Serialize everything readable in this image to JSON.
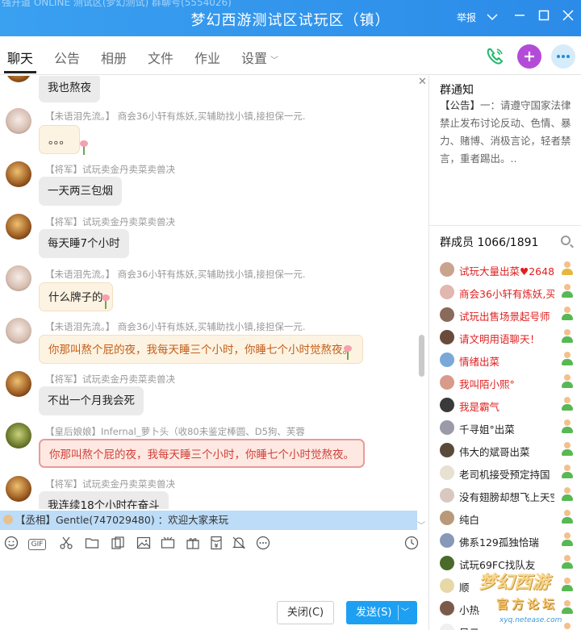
{
  "window": {
    "ghost_text": "强开道 ONLINE   测试区(梦幻测试)   群聊号(5554026)",
    "title": "梦幻西游测试区试玩区（镇）",
    "report_label": "举报"
  },
  "tabs": [
    {
      "label": "聊天"
    },
    {
      "label": "公告"
    },
    {
      "label": "相册"
    },
    {
      "label": "文件"
    },
    {
      "label": "作业"
    },
    {
      "label": "设置"
    }
  ],
  "messages": [
    {
      "meta": "",
      "text": "我也熬夜"
    },
    {
      "meta": "【未语泪先流。】 商会36小轩有炼妖,买辅助找小镇,接担保一元.",
      "text": "。。。"
    },
    {
      "meta": "【将军】试玩卖金丹卖菜卖兽决",
      "text": "一天两三包烟"
    },
    {
      "meta": "【将军】试玩卖金丹卖菜卖兽决",
      "text": "每天睡7个小时"
    },
    {
      "meta": "【未语泪先流。】 商会36小轩有炼妖,买辅助找小镇,接担保一元.",
      "text": "什么牌子的"
    },
    {
      "meta": "【未语泪先流。】 商会36小轩有炼妖,买辅助找小镇,接担保一元.",
      "text": "你那叫熬个屁的夜，我每天睡三个小时，你睡七个小时觉熬夜。"
    },
    {
      "meta": "【将军】试玩卖金丹卖菜卖兽决",
      "text": "不出一个月我会死"
    },
    {
      "meta": "【皇后娘娘】Infernal_萝卜头（收80未鉴定棒圆、D5狗、芙蓉",
      "text": "你那叫熬个屁的夜，我每天睡三个小时，你睡七个小时觉熬夜。"
    },
    {
      "meta": "【将军】试玩卖金丹卖菜卖兽决",
      "text": "我连续18个小时在奋斗"
    }
  ],
  "notice_strip": "【丞相】Gentle(747029480) ：欢迎大家来玩",
  "buttons": {
    "close_label": "关闭(C)",
    "send_label": "发送(S)"
  },
  "group_notice": {
    "title": "群通知",
    "tag": "【公告】",
    "body": "一：请遵守国家法律禁止发布讨论反动、色情、暴力、赌博、消极言论，轻者禁言，重者踢出。.."
  },
  "members": {
    "title": "群成员 1066/1891",
    "list": [
      {
        "name": "试玩大量出菜♥26485",
        "color": "#e02020"
      },
      {
        "name": "商会36小轩有炼妖,买",
        "color": "#e02020"
      },
      {
        "name": "试玩出售场景起号师",
        "color": "#e02020"
      },
      {
        "name": "请文明用语聊天！",
        "color": "#e02020"
      },
      {
        "name": "情绪出菜",
        "color": "#e02020"
      },
      {
        "name": "我叫陌小熙°",
        "color": "#e02020"
      },
      {
        "name": "我是霸气",
        "color": "#e02020"
      },
      {
        "name": "千寻姐°出菜",
        "color": "#222222"
      },
      {
        "name": "伟大的斌哥出菜",
        "color": "#222222"
      },
      {
        "name": "老司机接受预定持国",
        "color": "#222222"
      },
      {
        "name": "没有翅膀却想飞上天空",
        "color": "#222222"
      },
      {
        "name": "纯白",
        "color": "#222222"
      },
      {
        "name": "佛系129孤独恰瑞",
        "color": "#222222"
      },
      {
        "name": "试玩69FC找队友",
        "color": "#222222"
      },
      {
        "name": "顺",
        "color": "#222222"
      },
      {
        "name": "小热",
        "color": "#222222"
      },
      {
        "name": "风云",
        "color": "#222222"
      }
    ]
  },
  "watermark": {
    "big": "梦幻西游",
    "mid": "官方论坛",
    "url": "xyq.netease.com"
  }
}
